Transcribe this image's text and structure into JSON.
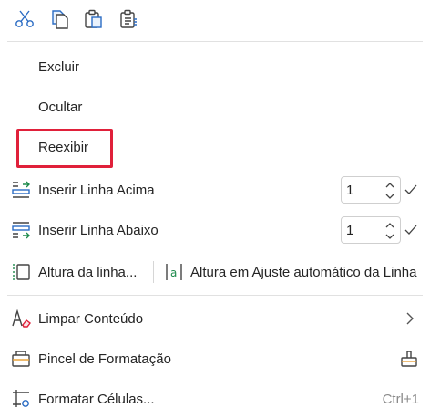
{
  "toolbar": {
    "buttons": [
      {
        "icon": "scissors-icon"
      },
      {
        "icon": "copy-icon"
      },
      {
        "icon": "paste-icon"
      },
      {
        "icon": "paste-special-icon"
      }
    ]
  },
  "menu": {
    "excluir": "Excluir",
    "ocultar": "Ocultar",
    "reexibir": "Reexibir",
    "inserir_acima": {
      "label": "Inserir Linha Acima",
      "value": "1"
    },
    "inserir_abaixo": {
      "label": "Inserir Linha Abaixo",
      "value": "1"
    },
    "altura_linha": "Altura da linha...",
    "altura_ajuste": "Altura em Ajuste automático da Linha",
    "limpar": "Limpar Conteúdo",
    "pincel": "Pincel de Formatação",
    "formatar": {
      "label": "Formatar Células...",
      "shortcut": "Ctrl+1"
    }
  },
  "colors": {
    "accent": "#2b6cc4",
    "highlight": "#e0203a",
    "green": "#1e8a4c"
  }
}
